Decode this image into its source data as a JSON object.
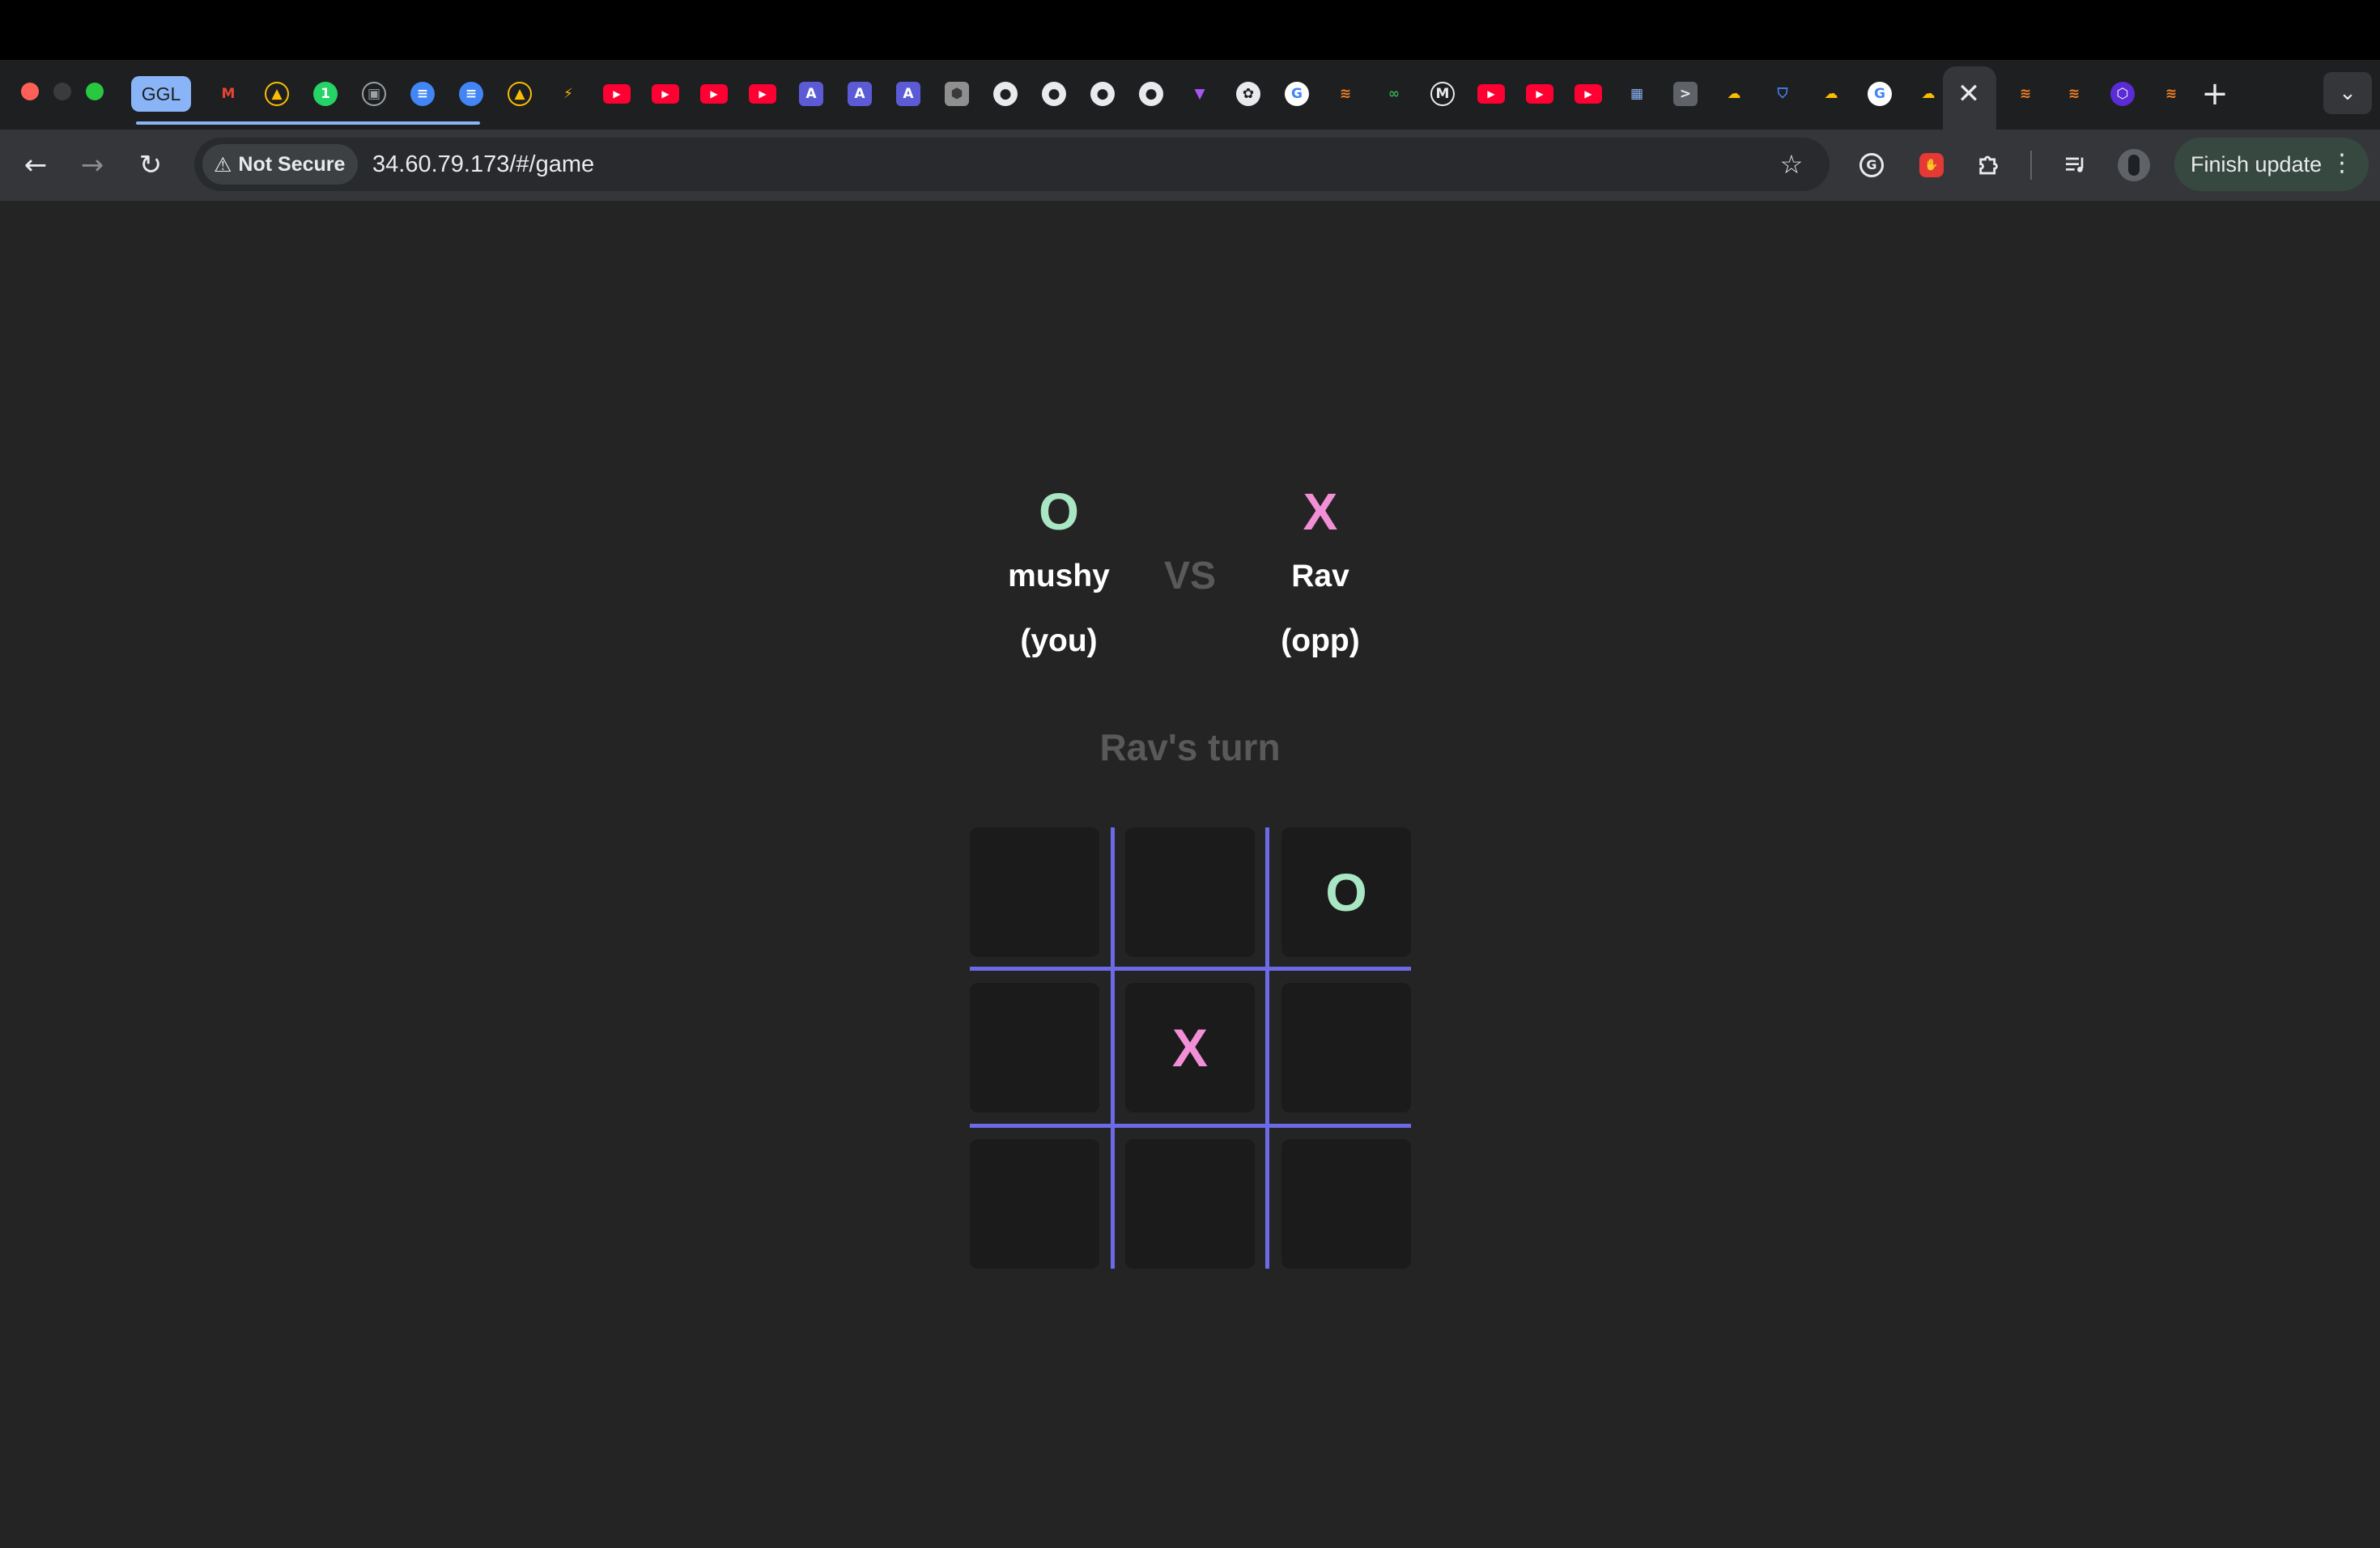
{
  "browser": {
    "pinned_tab_label": "GGL",
    "address": {
      "security_label": "Not Secure",
      "url": "34.60.79.173/#/game"
    },
    "finish_update_label": "Finish update",
    "tab_favicons": [
      "gmail-icon",
      "google-drive-icon",
      "whatsapp-icon",
      "screen-icon",
      "docs-icon",
      "docs-icon",
      "google-drive-icon",
      "lightning-icon",
      "youtube-icon",
      "youtube-icon",
      "youtube-icon",
      "youtube-icon",
      "app-icon",
      "app-icon",
      "app-icon",
      "cube-icon",
      "github-icon",
      "github-icon",
      "github-icon",
      "github-icon",
      "vite-icon",
      "openai-icon",
      "google-icon",
      "stack-icon",
      "link-icon",
      "m-icon",
      "youtube-icon",
      "youtube-icon",
      "youtube-icon",
      "chip-icon",
      "terminal-icon",
      "cloud-icon",
      "shield-icon",
      "cloud-icon",
      "google-icon",
      "cloud-icon",
      "close-icon",
      "stack-icon",
      "stack-icon",
      "hex-icon",
      "stack-icon"
    ]
  },
  "game": {
    "you": {
      "symbol": "O",
      "name": "mushy",
      "role": "(you)",
      "color": "#a8e6c4"
    },
    "vs_label": "VS",
    "opponent": {
      "symbol": "X",
      "name": "Rav",
      "role": "(opp)",
      "color": "#f28fd7"
    },
    "turn_text": "Rav's turn",
    "grid_line_color": "#6c6ae6",
    "board": [
      "",
      "",
      "O",
      "",
      "X",
      "",
      "",
      "",
      ""
    ]
  }
}
